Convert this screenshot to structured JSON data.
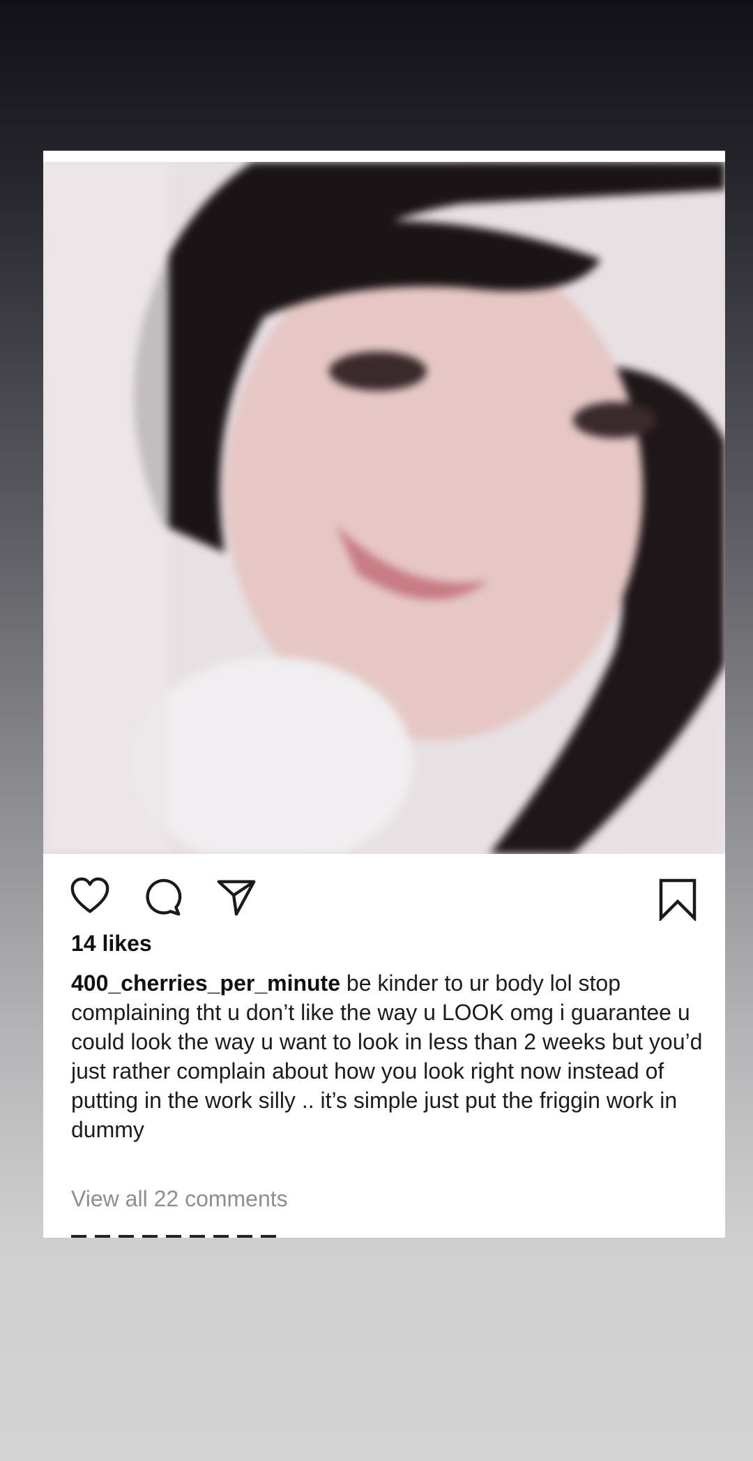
{
  "post": {
    "likes": "14 likes",
    "username": "400_cherries_per_minute",
    "caption": "be kinder to ur body lol stop complaining tht u don’t like the way u LOOK omg i guarantee u could look the way u want to look in less than 2 weeks but you’d just rather complain about how you look right now instead of putting in the work silly .. it’s simple just put the friggin work in dummy",
    "view_comments": "View all 22 comments"
  },
  "icons": [
    "heart-icon",
    "comment-icon",
    "share-icon",
    "bookmark-icon"
  ],
  "colors": {
    "text": "#1c1c1c",
    "muted": "#8e8e8e",
    "card": "#ffffff"
  }
}
